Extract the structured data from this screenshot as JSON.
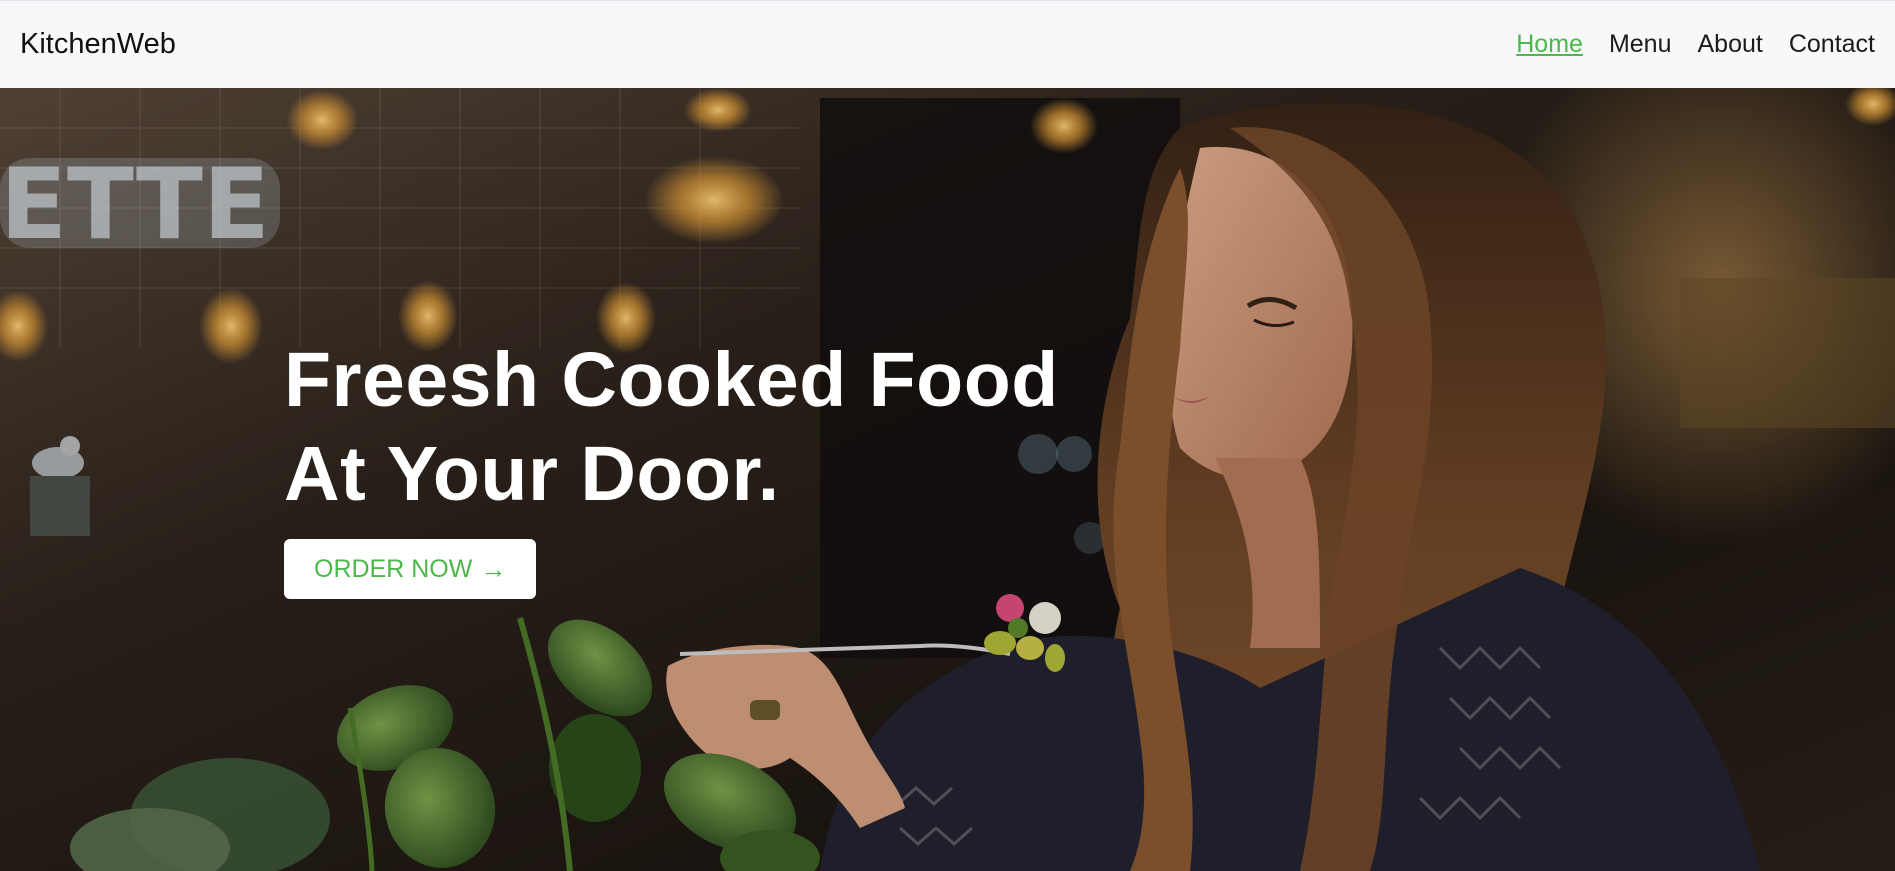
{
  "navbar": {
    "brand": "KitchenWeb",
    "links": [
      {
        "label": "Home",
        "active": true
      },
      {
        "label": "Menu",
        "active": false
      },
      {
        "label": "About",
        "active": false
      },
      {
        "label": "Contact",
        "active": false
      }
    ]
  },
  "hero": {
    "title_line_1": "Freesh Cooked Food",
    "title_line_2": "At Your Door.",
    "cta_label": "ORDER NOW",
    "cta_icon": "arrow-right-icon",
    "background_image": "photo-woman-eating-pasta-in-restaurant"
  },
  "colors": {
    "accent": "#4cb84a",
    "navbar_bg": "#f7f8fa",
    "hero_text": "#ffffff"
  }
}
